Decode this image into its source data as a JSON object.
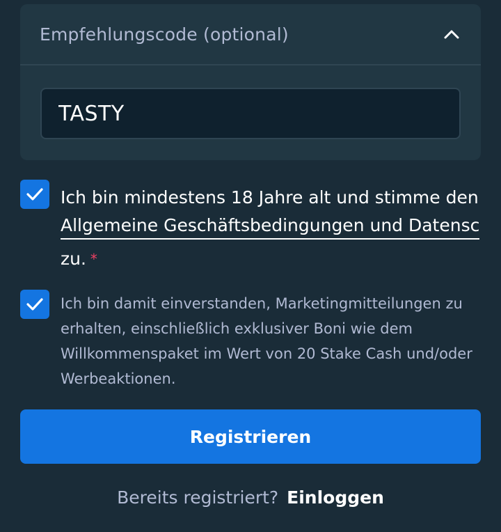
{
  "referral": {
    "header_label": "Empfehlungscode (optional)",
    "expanded": true,
    "code_value": "TASTY"
  },
  "terms": {
    "checked": true,
    "text_before": "Ich bin mindestens 18 Jahre alt und stimme den",
    "link_text": "Allgemeine Geschäftsbedingungen und Datensc",
    "text_after": "zu.",
    "required_marker": "*"
  },
  "marketing": {
    "checked": true,
    "text": "Ich bin damit einverstanden, Marketingmitteilungen zu erhalten, einschließlich exklusiver Boni wie dem Willkommenspaket im Wert von 20 Stake Cash und/oder Werbeaktionen."
  },
  "register_button": {
    "label": "Registrieren"
  },
  "login_prompt": {
    "text": "Bereits registriert?",
    "link_text": "Einloggen"
  },
  "colors": {
    "background": "#1a2c38",
    "panel": "#213743",
    "input_bg": "#0f212e",
    "accent": "#1475e1",
    "muted_text": "#b1bad3",
    "required": "#ed4163"
  },
  "icons": {
    "collapse": "chevron-up-icon",
    "check": "checkmark-icon"
  }
}
